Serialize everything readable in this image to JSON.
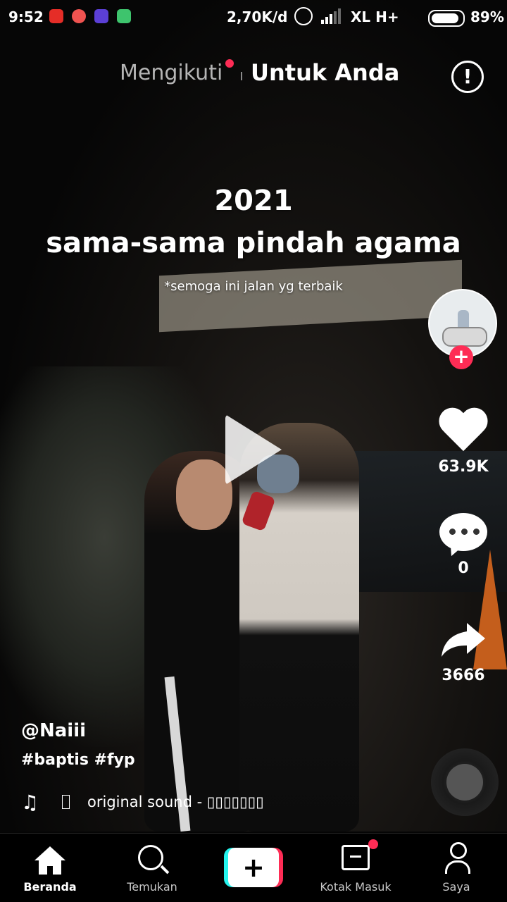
{
  "status_bar": {
    "time": "9:52",
    "network_speed": "2,70K/d",
    "carrier": "XL H+",
    "battery": "89%",
    "app_icons": [
      "youtube-icon",
      "recorder-icon",
      "photo-icon",
      "android-icon"
    ]
  },
  "top_tabs": {
    "following": "Mengikuti",
    "for_you": "Untuk Anda"
  },
  "video_overlay": {
    "year": "2021",
    "caption": "sama-sama pindah agama",
    "subtitle": "*semoga ini jalan yg terbaik"
  },
  "actions": {
    "likes": "63.9K",
    "comments": "0",
    "shares": "3666"
  },
  "post": {
    "username": "@Naiii",
    "hashtags": "#baptis #fyp",
    "sound": "original sound - ▯▯▯▯▯▯▯"
  },
  "bottom_nav": {
    "home": "Beranda",
    "discover": "Temukan",
    "inbox": "Kotak Masuk",
    "profile": "Saya"
  },
  "colors": {
    "accent": "#fe2c55",
    "cyan": "#25f4ee",
    "background": "#000000"
  }
}
